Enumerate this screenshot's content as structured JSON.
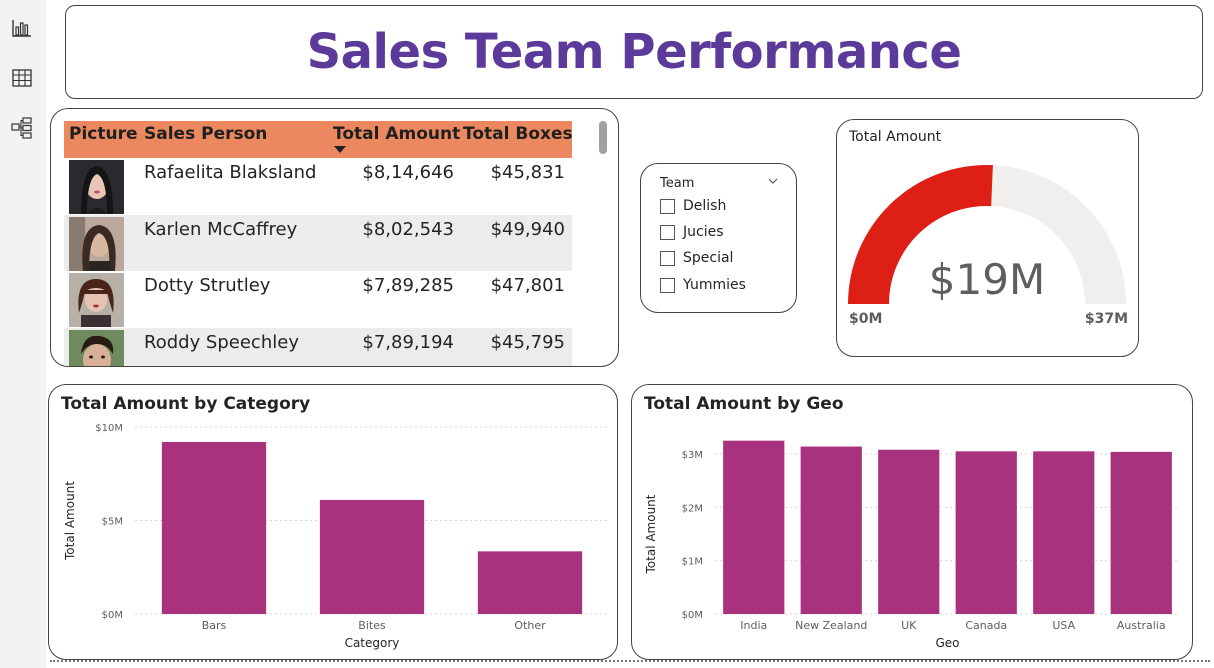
{
  "left_rail": {
    "icons": [
      "report-view-icon",
      "table-view-icon",
      "model-view-icon"
    ]
  },
  "header": {
    "title": "Sales Team Performance"
  },
  "table": {
    "columns": [
      "Picture",
      "Sales Person",
      "Total Amount",
      "Total Boxes"
    ],
    "sorted_column": "Total Amount",
    "sort_direction": "descending",
    "rows": [
      {
        "sales_person": "Rafaelita Blaksland",
        "total_amount": "$8,14,646",
        "total_boxes": "$45,831"
      },
      {
        "sales_person": "Karlen McCaffrey",
        "total_amount": "$8,02,543",
        "total_boxes": "$49,940"
      },
      {
        "sales_person": "Dotty Strutley",
        "total_amount": "$7,89,285",
        "total_boxes": "$47,801"
      },
      {
        "sales_person": "Roddy Speechley",
        "total_amount": "$7,89,194",
        "total_boxes": "$45,795"
      }
    ],
    "header_color": "#eb8860"
  },
  "slicer": {
    "title": "Team",
    "options": [
      {
        "label": "Delish",
        "checked": false
      },
      {
        "label": "Jucies",
        "checked": false
      },
      {
        "label": "Special",
        "checked": false
      },
      {
        "label": "Yummies",
        "checked": false
      }
    ]
  },
  "gauge": {
    "title": "Total Amount",
    "value_label": "$19M",
    "min_label": "$0M",
    "max_label": "$37M",
    "value": 19,
    "min": 0,
    "max": 37,
    "fill_color": "#de1f16",
    "track_color": "#f0efee"
  },
  "chart_data": [
    {
      "type": "bar",
      "title": "Total Amount by Category",
      "xlabel": "Category",
      "ylabel": "Total Amount",
      "categories": [
        "Bars",
        "Bites",
        "Other"
      ],
      "values": [
        9.2,
        6.1,
        3.35
      ],
      "value_unit": "$M",
      "y_ticks": [
        "$0M",
        "$5M",
        "$10M"
      ],
      "y_tick_values": [
        0,
        5,
        10
      ],
      "ylim": [
        0,
        10
      ],
      "grid": true,
      "color": "#a8327d"
    },
    {
      "type": "bar",
      "title": "Total Amount by Geo",
      "xlabel": "Geo",
      "ylabel": "Total Amount",
      "categories": [
        "India",
        "New Zealand",
        "UK",
        "Canada",
        "USA",
        "Australia"
      ],
      "values": [
        3.25,
        3.14,
        3.08,
        3.05,
        3.05,
        3.04
      ],
      "value_unit": "$M",
      "y_ticks": [
        "$0M",
        "$1M",
        "$2M",
        "$3M"
      ],
      "y_tick_values": [
        0,
        1,
        2,
        3
      ],
      "ylim": [
        0,
        3
      ],
      "grid": true,
      "color": "#a8327d"
    }
  ]
}
